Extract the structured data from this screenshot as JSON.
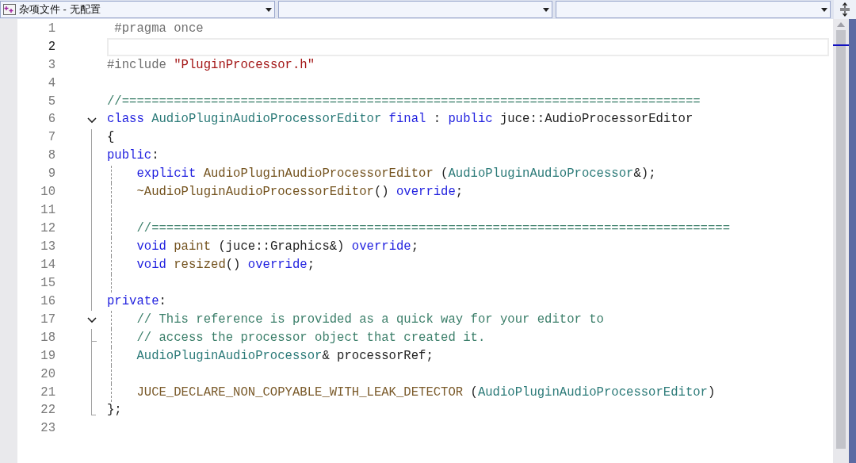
{
  "navigation_bar": [
    {
      "value": "杂项文件 - 无配置",
      "icon": true
    },
    {
      "icon": false
    },
    {
      "icon": false
    }
  ],
  "editor": {
    "lines": [
      {
        "number": "1",
        "current": false,
        "guide": false,
        "tokens": [
          {
            "text": " #pragma once",
            "kind": "preproc"
          }
        ]
      },
      {
        "number": "2",
        "current": true,
        "guide": false
      },
      {
        "number": "3",
        "current": false,
        "guide": false,
        "tokens": [
          {
            "text": "#include ",
            "kind": "preproc"
          },
          {
            "text": "\"PluginProcessor.h\"",
            "kind": "string"
          }
        ]
      },
      {
        "number": "4",
        "current": false,
        "guide": false
      },
      {
        "number": "5",
        "current": false,
        "guide": false,
        "tokens": [
          {
            "text": "//==============================================================================",
            "kind": "comment"
          }
        ]
      },
      {
        "number": "6",
        "current": false,
        "kind": "start",
        "guide": false,
        "tokens": [
          {
            "text": "class ",
            "kind": "keyword"
          },
          {
            "text": "AudioPluginAudioProcessorEditor ",
            "kind": "type"
          },
          {
            "text": "final ",
            "kind": "keyword"
          },
          {
            "text": ": ",
            "kind": "plain"
          },
          {
            "text": "public ",
            "kind": "keyword"
          },
          {
            "text": "juce::AudioProcessorEditor",
            "kind": "plain"
          }
        ]
      },
      {
        "number": "7",
        "current": false,
        "kind": "inside",
        "guide": false,
        "tokens": [
          {
            "text": "{",
            "kind": "plain"
          }
        ]
      },
      {
        "number": "8",
        "current": false,
        "kind": "inside",
        "guide": false,
        "tokens": [
          {
            "text": "public",
            "kind": "keyword"
          },
          {
            "text": ":",
            "kind": "plain"
          }
        ]
      },
      {
        "number": "9",
        "current": false,
        "kind": "inside",
        "guide": true,
        "tokens": [
          {
            "text": "    explicit ",
            "kind": "keyword"
          },
          {
            "text": "AudioPluginAudioProcessorEditor ",
            "kind": "function"
          },
          {
            "text": "(",
            "kind": "plain"
          },
          {
            "text": "AudioPluginAudioProcessor",
            "kind": "type"
          },
          {
            "text": "&);",
            "kind": "plain"
          }
        ]
      },
      {
        "number": "10",
        "current": false,
        "kind": "inside",
        "guide": true,
        "tokens": [
          {
            "text": "    ~AudioPluginAudioProcessorEditor",
            "kind": "function"
          },
          {
            "text": "() ",
            "kind": "plain"
          },
          {
            "text": "override",
            "kind": "keyword"
          },
          {
            "text": ";",
            "kind": "plain"
          }
        ]
      },
      {
        "number": "11",
        "current": false,
        "kind": "inside",
        "guide": true
      },
      {
        "number": "12",
        "current": false,
        "kind": "inside",
        "guide": true,
        "tokens": [
          {
            "text": "    //==============================================================================",
            "kind": "comment"
          }
        ]
      },
      {
        "number": "13",
        "current": false,
        "kind": "inside",
        "guide": true,
        "tokens": [
          {
            "text": "    void ",
            "kind": "keyword"
          },
          {
            "text": "paint ",
            "kind": "function"
          },
          {
            "text": "(juce::Graphics&) ",
            "kind": "plain"
          },
          {
            "text": "override",
            "kind": "keyword"
          },
          {
            "text": ";",
            "kind": "plain"
          }
        ]
      },
      {
        "number": "14",
        "current": false,
        "kind": "inside",
        "guide": true,
        "tokens": [
          {
            "text": "    void ",
            "kind": "keyword"
          },
          {
            "text": "resized",
            "kind": "function"
          },
          {
            "text": "() ",
            "kind": "plain"
          },
          {
            "text": "override",
            "kind": "keyword"
          },
          {
            "text": ";",
            "kind": "plain"
          }
        ]
      },
      {
        "number": "15",
        "current": false,
        "kind": "inside",
        "guide": true
      },
      {
        "number": "16",
        "current": false,
        "kind": "inside",
        "guide": false,
        "tokens": [
          {
            "text": "private",
            "kind": "keyword"
          },
          {
            "text": ":",
            "kind": "plain"
          }
        ]
      },
      {
        "number": "17",
        "current": false,
        "kind": "start",
        "guide": true,
        "tokens": [
          {
            "text": "    // This reference is provided as a quick way for your editor to",
            "kind": "comment"
          }
        ]
      },
      {
        "number": "18",
        "current": false,
        "kind": "inner_end",
        "guide": true,
        "tokens": [
          {
            "text": "    // access the processor object that created it.",
            "kind": "comment"
          }
        ]
      },
      {
        "number": "19",
        "current": false,
        "kind": "inside",
        "guide": true,
        "tokens": [
          {
            "text": "    AudioPluginAudioProcessor",
            "kind": "type"
          },
          {
            "text": "& processorRef;",
            "kind": "plain"
          }
        ]
      },
      {
        "number": "20",
        "current": false,
        "kind": "inside",
        "guide": true
      },
      {
        "number": "21",
        "current": false,
        "kind": "inside",
        "guide": true,
        "tokens": [
          {
            "text": "    JUCE_DECLARE_NON_COPYABLE_WITH_LEAK_DETECTOR ",
            "kind": "macro"
          },
          {
            "text": "(",
            "kind": "plain"
          },
          {
            "text": "AudioPluginAudioProcessorEditor",
            "kind": "type"
          },
          {
            "text": ")",
            "kind": "plain"
          }
        ]
      },
      {
        "number": "22",
        "current": false,
        "kind": "end",
        "guide": false,
        "tokens": [
          {
            "text": "};",
            "kind": "plain"
          }
        ]
      },
      {
        "number": "23",
        "current": false,
        "guide": false
      }
    ]
  }
}
